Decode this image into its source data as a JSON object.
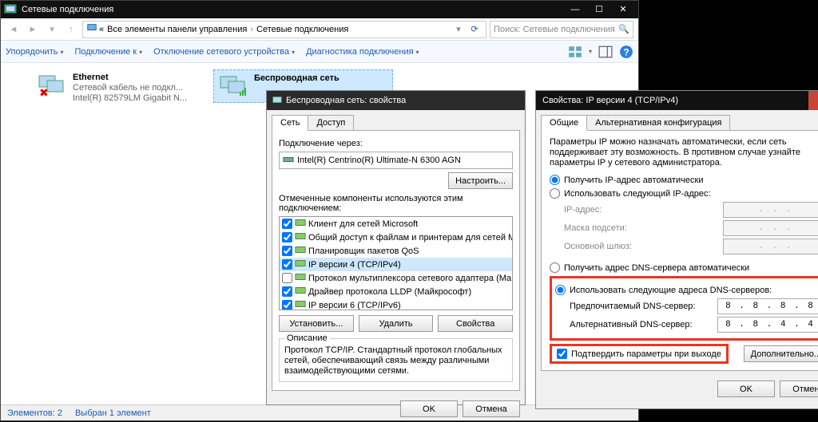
{
  "explorer": {
    "title": "Сетевые подключения",
    "breadcrumbKnob": "«",
    "breadcrumb1": "Все элементы панели управления",
    "breadcrumb2": "Сетевые подключения",
    "searchPlaceholder": "Поиск: Сетевые подключения",
    "cmd": {
      "organize": "Упорядочить",
      "connect": "Подключение к",
      "disable": "Отключение сетевого устройства",
      "diagnose": "Диагностика подключения"
    },
    "status": {
      "count": "Элементов: 2",
      "selected": "Выбран 1 элемент"
    },
    "conns": [
      {
        "name": "Ethernet",
        "line2": "Сетевой кабель не подкл...",
        "line3": "Intel(R) 82579LM Gigabit N..."
      },
      {
        "name": "Беспроводная сеть",
        "line2": "",
        "line3": ""
      }
    ]
  },
  "dlg1": {
    "title": "Беспроводная сеть: свойства",
    "tabs": [
      "Сеть",
      "Доступ"
    ],
    "connVia": "Подключение через:",
    "adapter": "Intel(R) Centrino(R) Ultimate-N 6300 AGN",
    "configure": "Настроить...",
    "checkedComponents": "Отмеченные компоненты используются этим подключением:",
    "components": [
      {
        "c": true,
        "label": "Клиент для сетей Microsoft"
      },
      {
        "c": true,
        "label": "Общий доступ к файлам и принтерам для сетей Mi"
      },
      {
        "c": true,
        "label": "Планировщик пакетов QoS"
      },
      {
        "c": true,
        "label": "IP версии 4 (TCP/IPv4)",
        "sel": true
      },
      {
        "c": false,
        "label": "Протокол мультиплексора сетевого адаптера (Ма"
      },
      {
        "c": true,
        "label": "Драйвер протокола LLDP (Майкрософт)"
      },
      {
        "c": true,
        "label": "IP версии 6 (TCP/IPv6)"
      }
    ],
    "install": "Установить...",
    "uninstall": "Удалить",
    "props": "Свойства",
    "descTitle": "Описание",
    "desc": "Протокол TCP/IP. Стандартный протокол глобальных сетей, обеспечивающий связь между различными взаимодействующими сетями.",
    "ok": "OK",
    "cancel": "Отмена"
  },
  "dlg2": {
    "title": "Свойства: IP версии 4 (TCP/IPv4)",
    "tabs": [
      "Общие",
      "Альтернативная конфигурация"
    ],
    "intro": "Параметры IP можно назначать автоматически, если сеть поддерживает эту возможность. В противном случае узнайте параметры IP у сетевого администратора.",
    "ipAuto": "Получить IP-адрес автоматически",
    "ipManual": "Использовать следующий IP-адрес:",
    "ipAddr": "IP-адрес:",
    "mask": "Маска подсети:",
    "gateway": "Основной шлюз:",
    "dnsAuto": "Получить адрес DNS-сервера автоматически",
    "dnsManual": "Использовать следующие адреса DNS-серверов:",
    "dnsPref": "Предпочитаемый DNS-сервер:",
    "dnsAlt": "Альтернативный DNS-сервер:",
    "dnsPrefVal": "8 . 8 . 8 . 8",
    "dnsAltVal": "8 . 8 . 4 . 4",
    "validate": "Подтвердить параметры при выходе",
    "advanced": "Дополнительно...",
    "ok": "OK",
    "cancel": "Отмена",
    "blankIp": " .   .   . "
  }
}
